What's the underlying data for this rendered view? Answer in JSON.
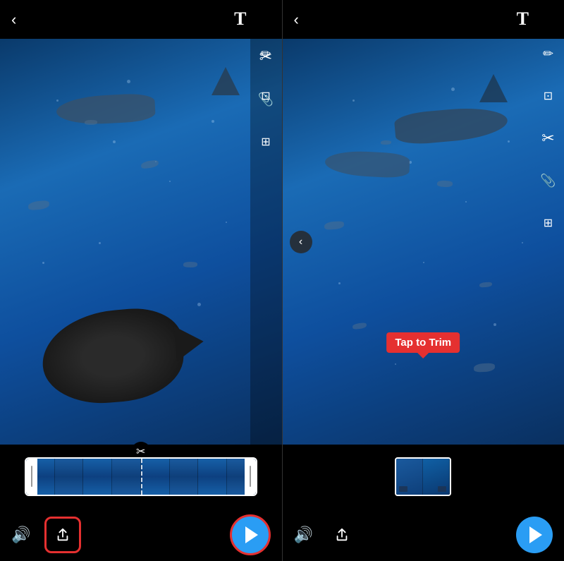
{
  "left_panel": {
    "back_arrow": "‹",
    "t_icon": "T",
    "icons": [
      "✏",
      "⊡",
      "✂",
      "🔗",
      "⊞"
    ],
    "timeline_scissors": "✂",
    "bottom": {
      "volume_icon": "🔊",
      "share_label": "↑",
      "play_label": "▶"
    }
  },
  "right_panel": {
    "back_arrow": "‹",
    "t_icon": "T",
    "icons": [
      "✏",
      "⊡",
      "✂",
      "🔗",
      "⊞"
    ],
    "chevron": "‹",
    "tap_to_trim_label": "Tap to Trim",
    "bottom": {
      "volume_icon": "🔊",
      "share_label": "↑",
      "play_label": "▶"
    }
  }
}
